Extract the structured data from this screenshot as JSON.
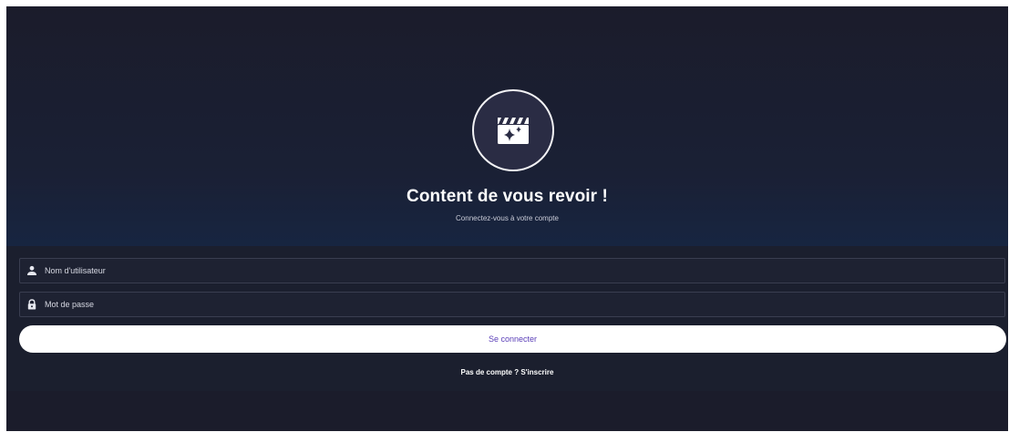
{
  "brand": {
    "logo_icon": "movie-sparkles-icon"
  },
  "hero": {
    "title": "Content de vous revoir !",
    "subtitle": "Connectez-vous à votre compte"
  },
  "form": {
    "username": {
      "icon": "person-icon",
      "placeholder": "Nom d'utilisateur",
      "value": ""
    },
    "password": {
      "icon": "lock-icon",
      "placeholder": "Mot de passe",
      "value": ""
    },
    "submit_label": "Se connecter",
    "signup_link": "Pas de compte ? S'inscrire"
  },
  "colors": {
    "background_top": "#1b1c2b",
    "background_bottom": "#133060",
    "form_panel": "#1b1f2e",
    "button_bg": "#ffffff",
    "button_text": "#5b3fb8"
  }
}
